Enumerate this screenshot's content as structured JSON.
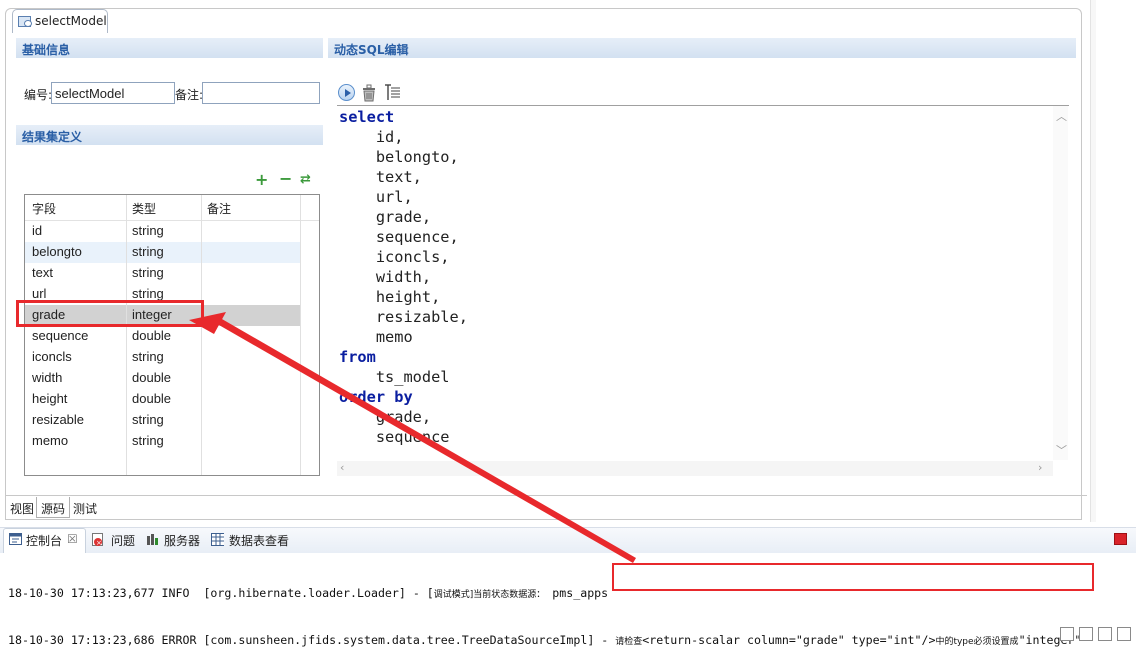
{
  "editor": {
    "tab_title": "selectModel",
    "bottom_tabs": [
      "视图",
      "源码",
      "测试"
    ]
  },
  "basic_info": {
    "header": "基础信息",
    "id_label": "编号:",
    "id_value": "selectModel",
    "note_label": "备注:",
    "note_value": ""
  },
  "result_set": {
    "header": "结果集定义",
    "columns": [
      "字段",
      "类型",
      "备注"
    ],
    "rows": [
      {
        "field": "id",
        "type": "string",
        "note": ""
      },
      {
        "field": "belongto",
        "type": "string",
        "note": ""
      },
      {
        "field": "text",
        "type": "string",
        "note": ""
      },
      {
        "field": "url",
        "type": "string",
        "note": ""
      },
      {
        "field": "grade",
        "type": "integer",
        "note": ""
      },
      {
        "field": "sequence",
        "type": "double",
        "note": ""
      },
      {
        "field": "iconcls",
        "type": "string",
        "note": ""
      },
      {
        "field": "width",
        "type": "double",
        "note": ""
      },
      {
        "field": "height",
        "type": "double",
        "note": ""
      },
      {
        "field": "resizable",
        "type": "string",
        "note": ""
      },
      {
        "field": "memo",
        "type": "string",
        "note": ""
      }
    ],
    "selected_field": "grade",
    "add_label": "+",
    "remove_label": "−",
    "refresh_label": "⇄"
  },
  "sql_editor": {
    "header": "动态SQL编辑",
    "lines": [
      {
        "kw": "select",
        "text": ""
      },
      {
        "kw": "",
        "text": "    id,"
      },
      {
        "kw": "",
        "text": "    belongto,"
      },
      {
        "kw": "",
        "text": "    text,"
      },
      {
        "kw": "",
        "text": "    url,"
      },
      {
        "kw": "",
        "text": "    grade,"
      },
      {
        "kw": "",
        "text": "    sequence,"
      },
      {
        "kw": "",
        "text": "    iconcls,"
      },
      {
        "kw": "",
        "text": "    width,"
      },
      {
        "kw": "",
        "text": "    height,"
      },
      {
        "kw": "",
        "text": "    resizable,"
      },
      {
        "kw": "",
        "text": "    memo"
      },
      {
        "kw": "from",
        "text": ""
      },
      {
        "kw": "",
        "text": "    ts_model"
      },
      {
        "kw": "order by",
        "text": ""
      },
      {
        "kw": "",
        "text": "    grade,"
      },
      {
        "kw": "",
        "text": "    sequence"
      }
    ]
  },
  "console": {
    "tabs": [
      {
        "label": "控制台",
        "icon": "console-icon"
      },
      {
        "label": "问题",
        "icon": "problems-icon"
      },
      {
        "label": "服务器",
        "icon": "servers-icon"
      },
      {
        "label": "数据表查看",
        "icon": "table-icon"
      }
    ],
    "close_glyph": "☒",
    "log": [
      {
        "prefix": "18-10-30 17:13:23,677 INFO  [org.hibernate.loader.Loader] - [",
        "small": "调试模式]当前状态数据源：",
        "suffix": " pms_apps"
      },
      {
        "prefix": "18-10-30 17:13:23,686 ERROR [com.sunsheen.jfids.system.data.tree.TreeDataSourceImpl] - ",
        "small_a": "请检查",
        "mid": "<return-scalar column=\"grade\" type=\"int\"/>",
        "small_b": "中的type必须设置成",
        "tail": "\"integer\""
      }
    ]
  },
  "colors": {
    "annotation": "#e8292c",
    "header_text": "#2a5fa6",
    "sql_keyword": "#0a1ea0"
  }
}
